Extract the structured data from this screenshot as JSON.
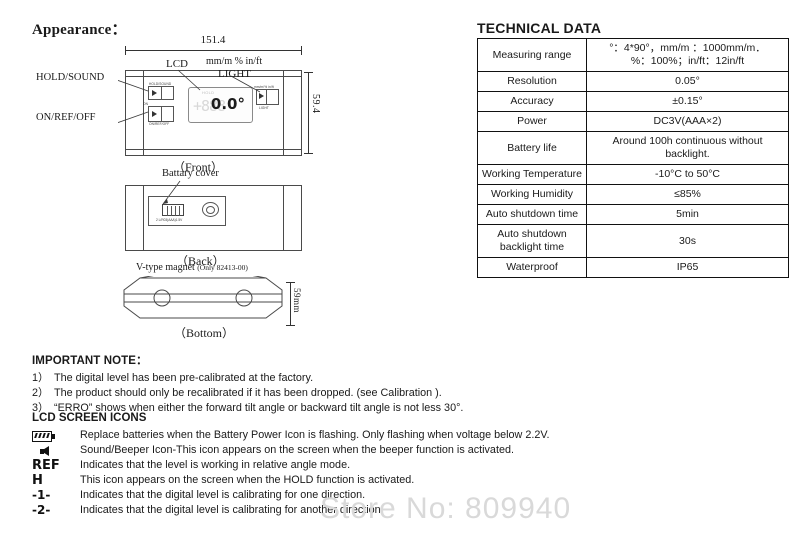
{
  "left": {
    "appearance_heading": "Appearance：",
    "front": {
      "dim_width": "151.4",
      "dim_height": "59.4",
      "label_hold_sound": "HOLD/SOUND",
      "label_on_ref_off": "ON/REF/OFF",
      "label_lcd": "LCD",
      "label_units": "mm/m % in/ft",
      "label_light": "LIGHT",
      "btn_hold_micro": "HOLD/SOUND",
      "btn_on_micro": "ON/REF/OFF",
      "btn_on_micro2": "ON",
      "btn_light_micro": "mm/m/% in/ft",
      "btn_light_micro2": "LIGHT",
      "lcd_ghost": "+888",
      "lcd_value": "0.0°",
      "lcd_mini": "HOLD",
      "caption": "（Front）"
    },
    "back": {
      "label_battery_cover": "Battary cover",
      "battery_micro": "2 L/R03(AAA)1.5V",
      "caption": "（Back）"
    },
    "bottom": {
      "label_vmagnet": "V-type magnet",
      "label_vmagnet_note": "(Only 82413-00)",
      "dim_height": "59mm",
      "caption": "（Bottom）"
    }
  },
  "important_note": {
    "heading": "IMPORTANT NOTE：",
    "items": [
      {
        "num": "1）",
        "text": "The digital level has been pre-calibrated at the factory."
      },
      {
        "num": "2）",
        "text": "The product should only be recalibrated if it has been dropped. (see Calibration )."
      },
      {
        "num": "3）",
        "text": "“ERRO” shows when either the forward tilt angle or backward tilt angle is not less 30°."
      }
    ]
  },
  "lcd_icons": {
    "heading": "LCD SCREEN ICONS",
    "rows": [
      {
        "icon": "battery-icon",
        "glyph": "",
        "desc": "Replace batteries when the Battery Power Icon is flashing. Only flashing when voltage below 2.2V."
      },
      {
        "icon": "speaker-icon",
        "glyph": "",
        "desc": "Sound/Beeper Icon-This icon appears on the screen when the beeper function is activated."
      },
      {
        "icon": "ref-icon",
        "glyph": "REF",
        "desc": "Indicates that the level is working in relative angle mode."
      },
      {
        "icon": "hold-icon",
        "glyph": "H",
        "desc": "This icon appears on the screen when the HOLD function is activated."
      },
      {
        "icon": "calibration-1-icon",
        "glyph": "-1-",
        "desc": "Indicates that the digital level is calibrating for one direction."
      },
      {
        "icon": "calibration-2-icon",
        "glyph": "-2-",
        "desc": "Indicates that the digital level is calibrating for another direction."
      }
    ]
  },
  "technical_data": {
    "heading": "TECHNICAL DATA",
    "rows": [
      {
        "key": "Measuring range",
        "value": "°：4*90°，mm/m ：1000mm/m．\n%：100%；in/ft：12in/ft"
      },
      {
        "key": "Resolution",
        "value": "0.05°"
      },
      {
        "key": "Accuracy",
        "value": "±0.15°"
      },
      {
        "key": "Power",
        "value": "DC3V(AAA×2)"
      },
      {
        "key": "Battery life",
        "value": "Around 100h continuous without backlight."
      },
      {
        "key": "Working Temperature",
        "value": "-10°C to 50°C"
      },
      {
        "key": "Working Humidity",
        "value": "≤85%"
      },
      {
        "key": "Auto shutdown time",
        "value": "5min"
      },
      {
        "key": "Auto shutdown backlight time",
        "value": "30s"
      },
      {
        "key": "Waterproof",
        "value": "IP65"
      }
    ]
  },
  "watermark": {
    "text": "Store No: 809940"
  }
}
